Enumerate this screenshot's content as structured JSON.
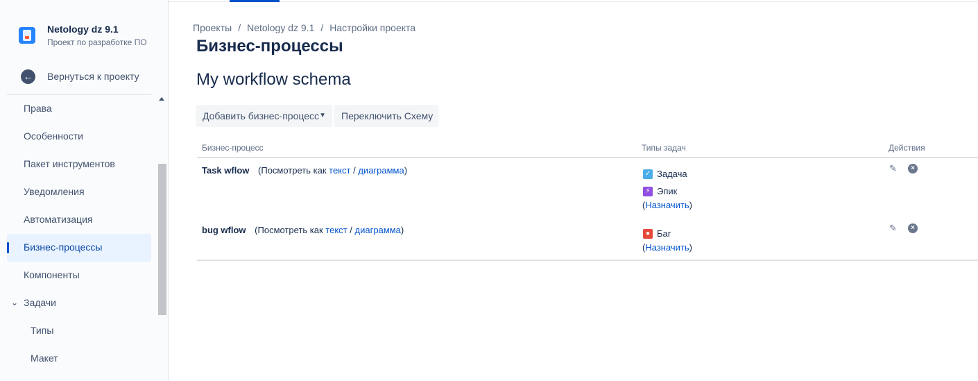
{
  "project": {
    "name": "Netology dz 9.1",
    "type": "Проект по разработке ПО"
  },
  "back_label": "Вернуться к проекту",
  "nav": {
    "items": [
      {
        "label": "Права"
      },
      {
        "label": "Особенности"
      },
      {
        "label": "Пакет инструментов"
      },
      {
        "label": "Уведомления"
      },
      {
        "label": "Автоматизация"
      },
      {
        "label": "Бизнес-процессы",
        "active": true
      },
      {
        "label": "Компоненты"
      },
      {
        "label": "Задачи",
        "expanded": true
      },
      {
        "label": "Типы",
        "sub": true
      },
      {
        "label": "Макет",
        "sub": true
      }
    ]
  },
  "breadcrumbs": [
    "Проекты",
    "Netology dz 9.1",
    "Настройки проекта"
  ],
  "page_title": "Бизнес-процессы",
  "schema_title": "My workflow schema",
  "buttons": {
    "add": "Добавить бизнес-процесс",
    "switch": "Переключить Схему"
  },
  "table": {
    "headers": {
      "workflow": "Бизнес-процесс",
      "types": "Типы задач",
      "actions": "Действия"
    },
    "view_prefix": "(Посмотреть как",
    "view_text": "текст",
    "view_sep": "/",
    "view_diagram": "диаграмма",
    "view_suffix": ")",
    "assign_open": "(",
    "assign_label": "Назначить",
    "assign_close": ")",
    "rows": [
      {
        "name": "Task wflow",
        "types": [
          {
            "label": "Задача",
            "icon": "task-checkbox-icon",
            "color": "#4bade8"
          },
          {
            "label": "Эпик",
            "icon": "epic-lightning-icon",
            "color": "#904ee2"
          }
        ]
      },
      {
        "name": "bug wflow",
        "types": [
          {
            "label": "Баг",
            "icon": "bug-dot-icon",
            "color": "#e5493a"
          }
        ]
      }
    ]
  },
  "colors": {
    "accent": "#0052cc",
    "active_bg": "#e9f2ff"
  }
}
